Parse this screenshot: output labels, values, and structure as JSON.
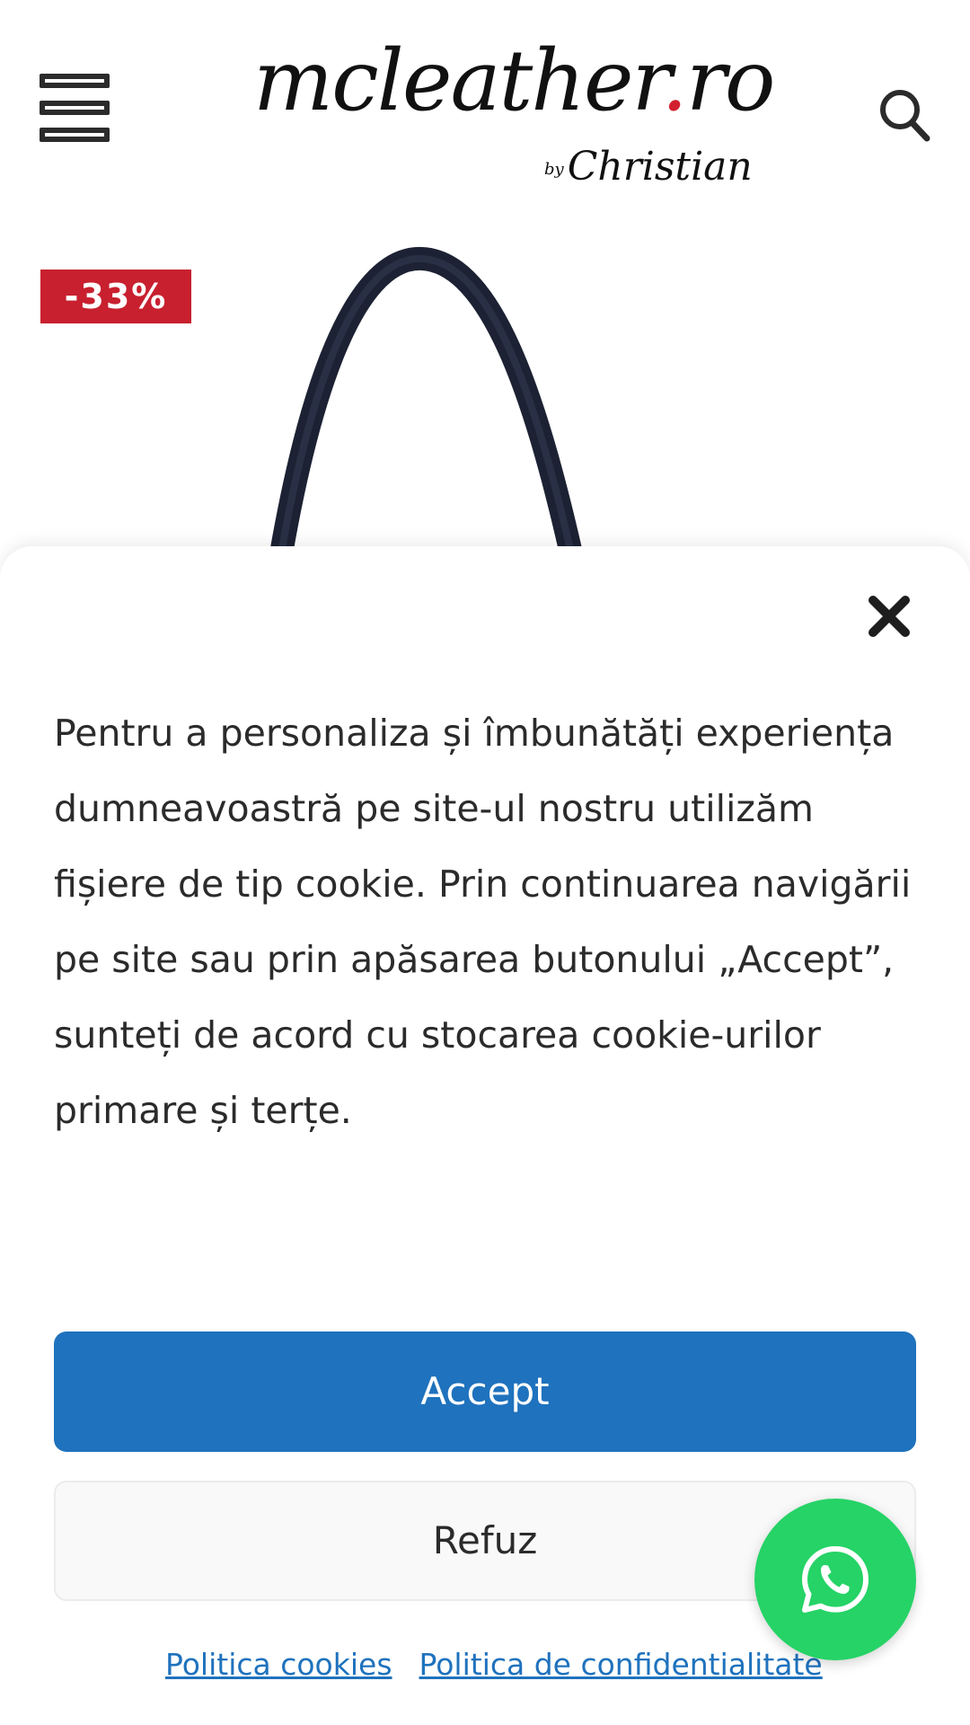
{
  "header": {
    "menu_icon": "hamburger-menu-icon",
    "logo_main_prefix": "mcleather",
    "logo_dot": ".",
    "logo_main_suffix": "ro",
    "logo_by": "by",
    "logo_sub": "Christian",
    "search_icon": "search-icon"
  },
  "product": {
    "discount_badge": "-33%",
    "image_icon": "handbag-image"
  },
  "cookie_banner": {
    "close_icon": "close-icon",
    "message": "Pentru a personaliza și îmbunătăți experiența dumneavoastră pe site-ul nostru utilizăm fișiere de tip cookie. Prin continuarea navigării pe site sau prin apăsarea butonului „Accept”, sunteți de acord cu stocarea cookie-urilor primare și terțe.",
    "accept_label": "Accept",
    "refuse_label": "Refuz",
    "links": [
      "Politica cookies",
      "Politica de confidentialitate"
    ]
  },
  "whatsapp": {
    "icon": "whatsapp-icon"
  },
  "colors": {
    "accent_blue": "#1f72bd",
    "badge_red": "#c8202f",
    "whatsapp_green": "#25d366",
    "text": "#2b2b2b"
  }
}
